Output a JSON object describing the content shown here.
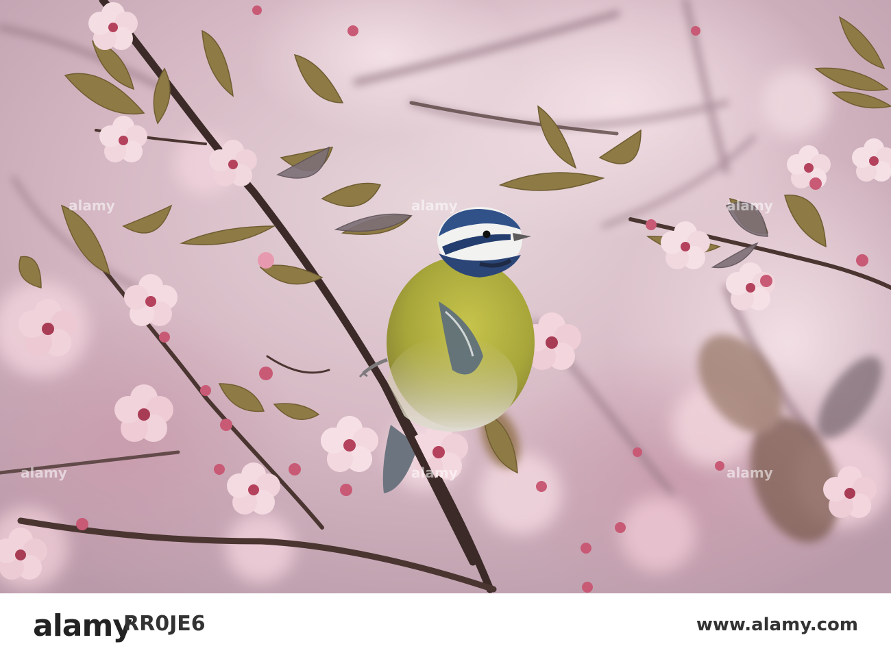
{
  "image": {
    "subject": "Blue tit perched on a branch among pink cherry plum blossoms",
    "palette": {
      "background_pink": "#d9bfc9",
      "blossom_pink": "#f3d6de",
      "blossom_center": "#b7445e",
      "leaf_bronze": "#8f7a45",
      "branch_brown": "#3d2a28",
      "bird_yellow": "#b8b640",
      "bird_blue": "#2f4f85",
      "bird_white": "#f1f1f1"
    }
  },
  "watermark": {
    "brand": "alamy",
    "image_id": "RR0JE6",
    "site": "www.alamy.com"
  }
}
